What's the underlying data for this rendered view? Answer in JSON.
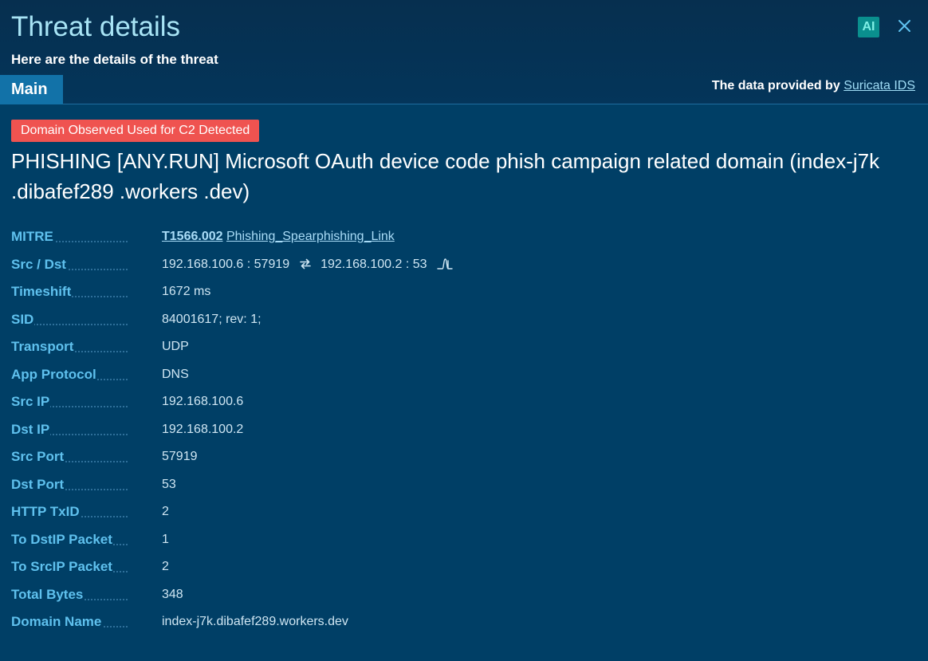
{
  "header": {
    "title": "Threat details",
    "subtitle": "Here are the details of the threat",
    "ai_label": "AI",
    "tab_main": "Main",
    "provider_prefix": "The data provided by",
    "provider_link": "Suricata IDS"
  },
  "threat": {
    "badge": "Domain Observed Used for C2 Detected",
    "badge_color": "#ef5350",
    "title": "PHISHING [ANY.RUN] Microsoft OAuth device code phish campaign related domain (index-j7k .dibafef289 .workers .dev)"
  },
  "details": {
    "mitre": {
      "label": "MITRE",
      "code": "T1566.002",
      "name": "Phishing_Spearphishing_Link"
    },
    "src_dst": {
      "label": "Src / Dst",
      "src": "192.168.100.6 : 57919",
      "dst": "192.168.100.2 : 53"
    },
    "timeshift": {
      "label": "Timeshift",
      "value": "1672 ms"
    },
    "sid": {
      "label": "SID",
      "value": "84001617; rev: 1;"
    },
    "transport": {
      "label": "Transport",
      "value": "UDP"
    },
    "app_protocol": {
      "label": "App Protocol",
      "value": "DNS"
    },
    "src_ip": {
      "label": "Src IP",
      "value": "192.168.100.6"
    },
    "dst_ip": {
      "label": "Dst IP",
      "value": "192.168.100.2"
    },
    "src_port": {
      "label": "Src Port",
      "value": "57919"
    },
    "dst_port": {
      "label": "Dst Port",
      "value": "53"
    },
    "http_txid": {
      "label": "HTTP TxID",
      "value": "2"
    },
    "to_dstip_packet": {
      "label": "To DstIP Packet",
      "value": "1"
    },
    "to_srcip_packet": {
      "label": "To SrcIP Packet",
      "value": "2"
    },
    "total_bytes": {
      "label": "Total Bytes",
      "value": "348"
    },
    "domain_name": {
      "label": "Domain Name",
      "value": "index-j7k.dibafef289.workers.dev"
    }
  },
  "icons": {
    "close": "close-icon",
    "swap": "swap-arrows-icon",
    "signal": "signal-pulse-icon"
  },
  "colors": {
    "background": "#003f66",
    "title": "#a8e4f5",
    "label": "#5fc1ee",
    "tab": "#1272a8",
    "ai_badge": "#0a8f8e"
  }
}
